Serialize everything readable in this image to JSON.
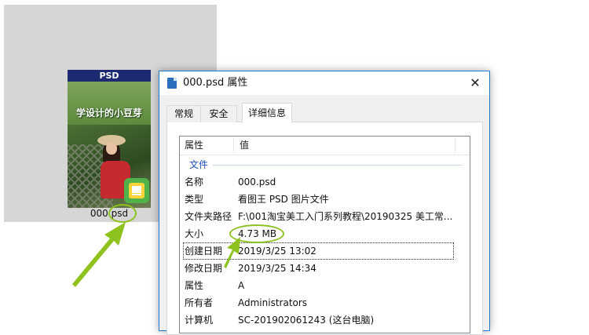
{
  "thumbnail": {
    "badge": "PSD",
    "caption": "学设计的小豆芽",
    "filename": "000.psd"
  },
  "dialog": {
    "title": "000.psd 属性",
    "tabs": [
      {
        "label": "常规"
      },
      {
        "label": "安全"
      },
      {
        "label": "详细信息"
      }
    ],
    "active_tab": "详细信息",
    "columns": {
      "property": "属性",
      "value": "值"
    },
    "group": "文件",
    "rows": [
      {
        "name": "名称",
        "value": "000.psd"
      },
      {
        "name": "类型",
        "value": "看图王 PSD 图片文件"
      },
      {
        "name": "文件夹路径",
        "value": "F:\\001淘宝美工入门系列教程\\20190325 美工常..."
      },
      {
        "name": "大小",
        "value": "4.73 MB"
      },
      {
        "name": "创建日期",
        "value": "2019/3/25 13:02"
      },
      {
        "name": "修改日期",
        "value": "2019/3/25 14:34"
      },
      {
        "name": "属性",
        "value": "A"
      },
      {
        "name": "所有者",
        "value": "Administrators"
      },
      {
        "name": "计算机",
        "value": "SC-201902061243 (这台电脑)"
      }
    ]
  },
  "colors": {
    "highlight": "#8dc21f",
    "dialog_border": "#1e7bd0",
    "group_label": "#1e4fbf"
  },
  "icons": [
    "file-icon",
    "close-icon",
    "psd-app-icon",
    "arrow-icon"
  ]
}
